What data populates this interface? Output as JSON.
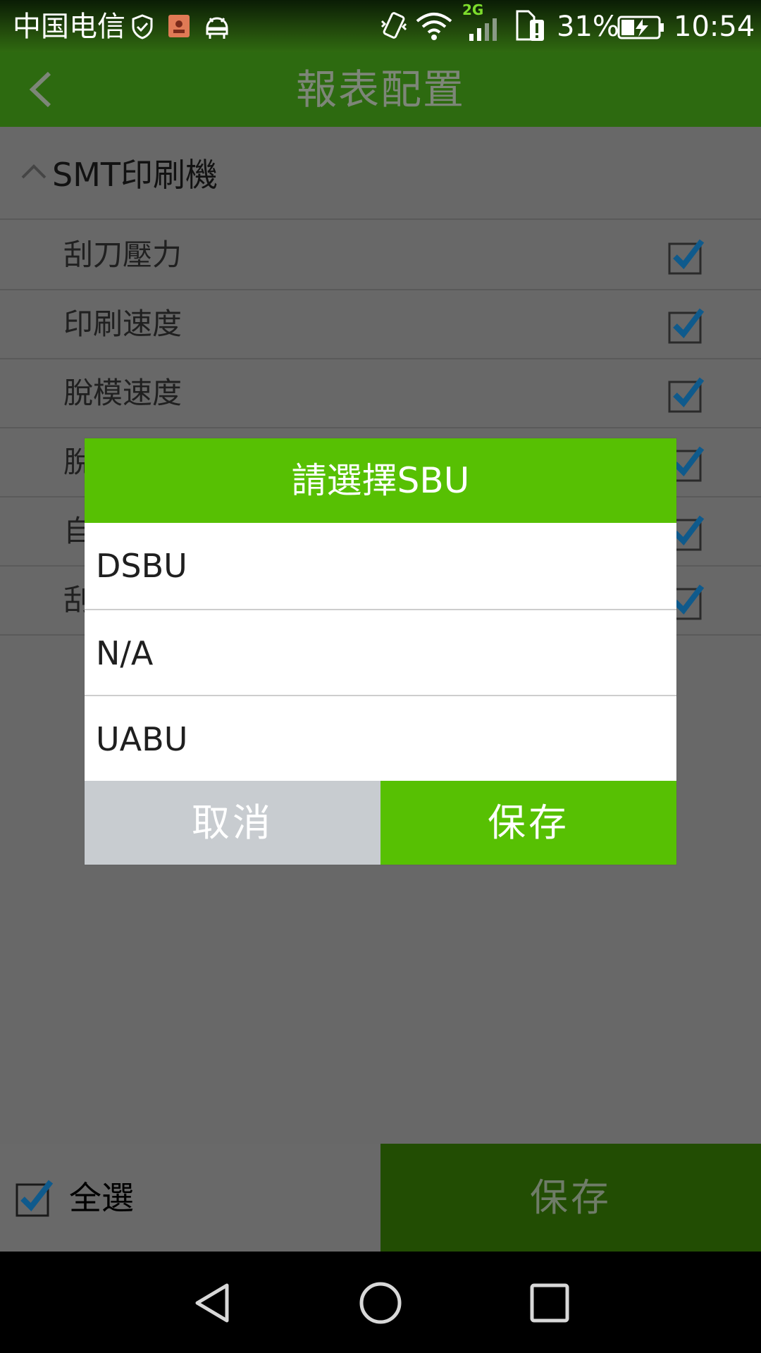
{
  "status_bar": {
    "carrier": "中国电信",
    "network_type": "2G",
    "battery": "31%",
    "time": "10:54"
  },
  "header": {
    "title": "報表配置",
    "back_icon": "chevron-left-icon"
  },
  "section": {
    "title": "SMT印刷機",
    "expanded": true
  },
  "rows": [
    {
      "label": "刮刀壓力",
      "checked": true
    },
    {
      "label": "印刷速度",
      "checked": true
    },
    {
      "label": "脫模速度",
      "checked": true
    },
    {
      "label": "脫",
      "checked": true
    },
    {
      "label": "自",
      "checked": true
    },
    {
      "label": "刮",
      "checked": true
    }
  ],
  "dialog": {
    "title": "請選擇SBU",
    "options": [
      "DSBU",
      "N/A",
      "UABU"
    ],
    "cancel_label": "取消",
    "save_label": "保存"
  },
  "bottom_bar": {
    "select_all_label": "全選",
    "select_all_checked": true,
    "save_label": "保存"
  },
  "colors": {
    "accent_green": "#57c003",
    "dim_green": "#2d6a10",
    "check_blue": "#0f5a8c"
  }
}
